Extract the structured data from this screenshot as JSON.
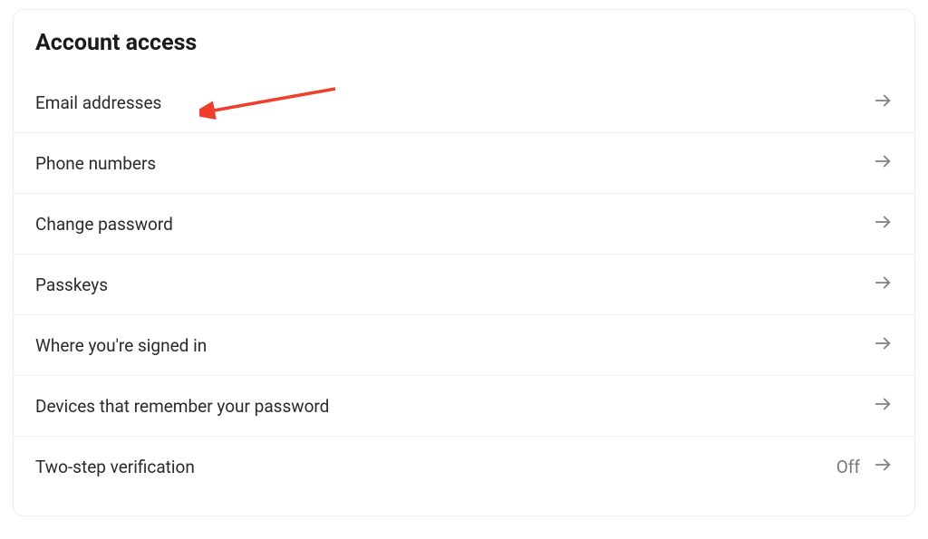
{
  "section": {
    "title": "Account access",
    "items": [
      {
        "label": "Email addresses",
        "status": ""
      },
      {
        "label": "Phone numbers",
        "status": ""
      },
      {
        "label": "Change password",
        "status": ""
      },
      {
        "label": "Passkeys",
        "status": ""
      },
      {
        "label": "Where you're signed in",
        "status": ""
      },
      {
        "label": "Devices that remember your password",
        "status": ""
      },
      {
        "label": "Two-step verification",
        "status": "Off"
      }
    ]
  }
}
